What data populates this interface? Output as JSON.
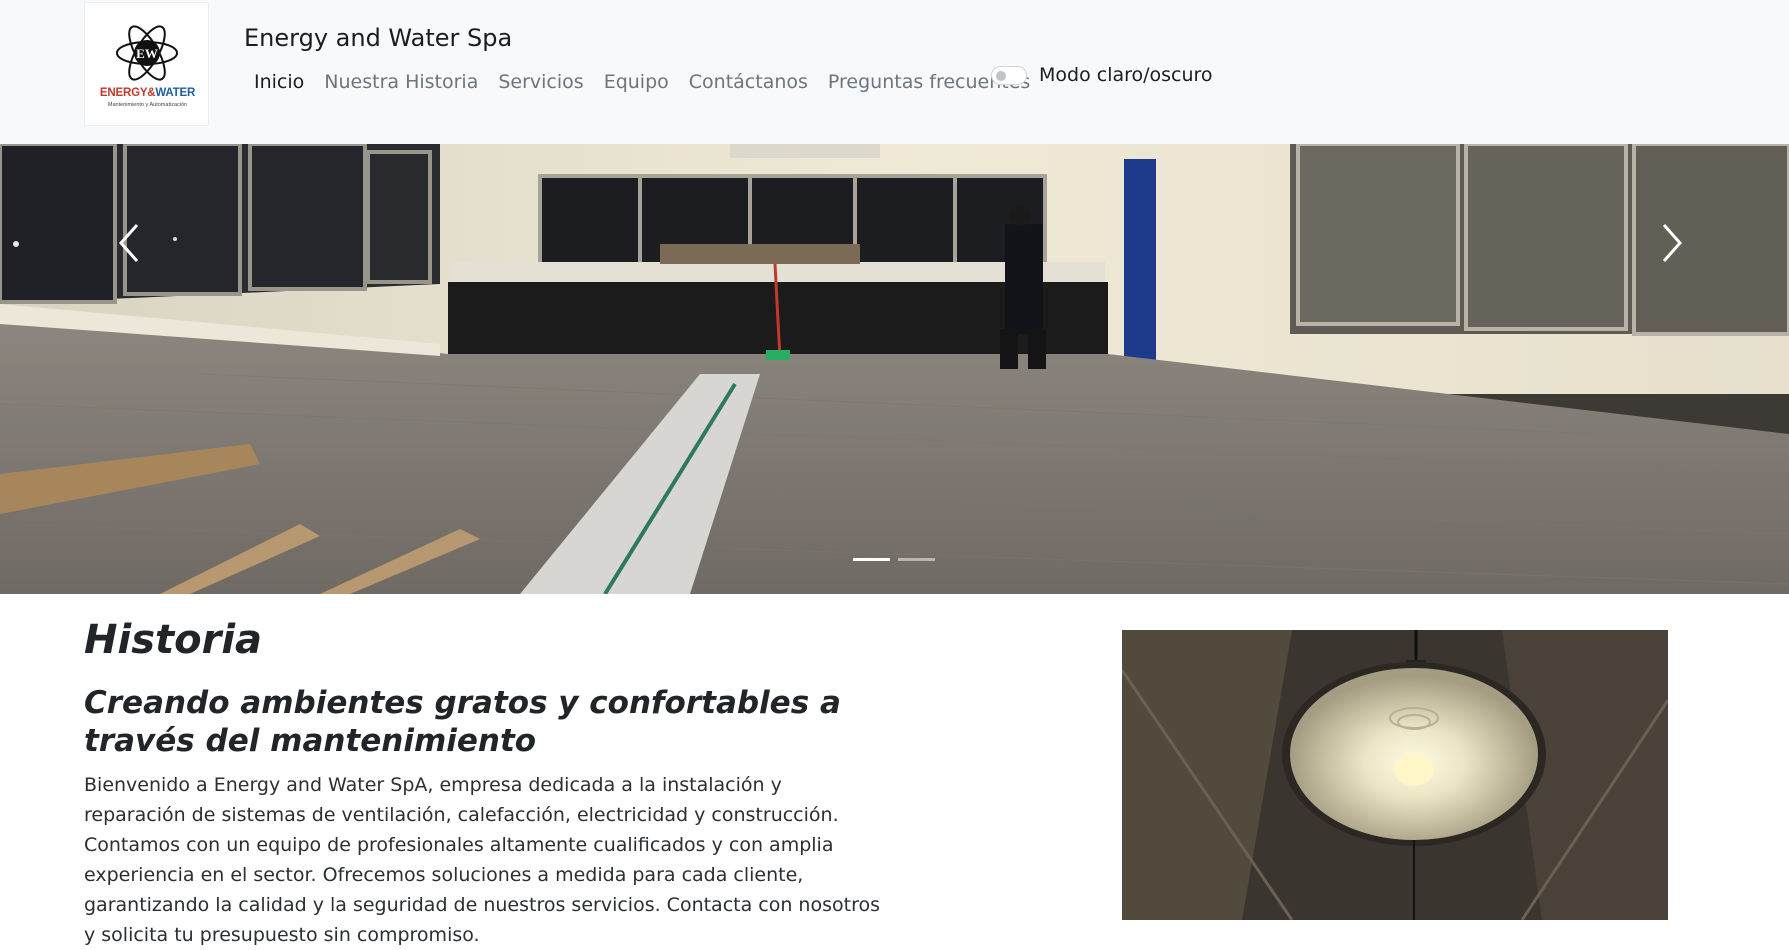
{
  "navbar": {
    "logo_monogram": "EW",
    "logo_text_energy": "ENERGY&",
    "logo_text_water": "WATER",
    "logo_subtitle": "Mantenimiento y Automatización",
    "brand": "Energy and Water Spa",
    "links": [
      {
        "label": "Inicio",
        "active": true
      },
      {
        "label": "Nuestra Historia",
        "active": false
      },
      {
        "label": "Servicios",
        "active": false
      },
      {
        "label": "Equipo",
        "active": false
      },
      {
        "label": "Contáctanos",
        "active": false
      },
      {
        "label": "Preguntas frecuentes",
        "active": false
      }
    ],
    "theme_toggle_label": "Modo claro/oscuro",
    "theme_toggle_on": false
  },
  "carousel": {
    "slide_count": 2,
    "active_slide": 1
  },
  "history": {
    "title": "Historia",
    "subtitle": "Creando ambientes gratos y confortables a través del mantenimiento",
    "body": "Bienvenido a Energy and Water SpA, empresa dedicada a la instalación y reparación de sistemas de ventilación, calefacción, electricidad y construcción. Contamos con un equipo de profesionales altamente cualificados y con amplia experiencia en el sector. Ofrecemos soluciones a medida para cada cliente, garantizando la calidad y la seguridad de nuestros servicios. Contacta con nosotros y solicita tu presupuesto sin compromiso."
  },
  "colors": {
    "navbar_bg": "#f8f9fa",
    "nav_active": "#1d1d1d",
    "nav_inactive": "#6c757d",
    "logo_red": "#c0392b",
    "logo_blue": "#1f5fa0"
  }
}
